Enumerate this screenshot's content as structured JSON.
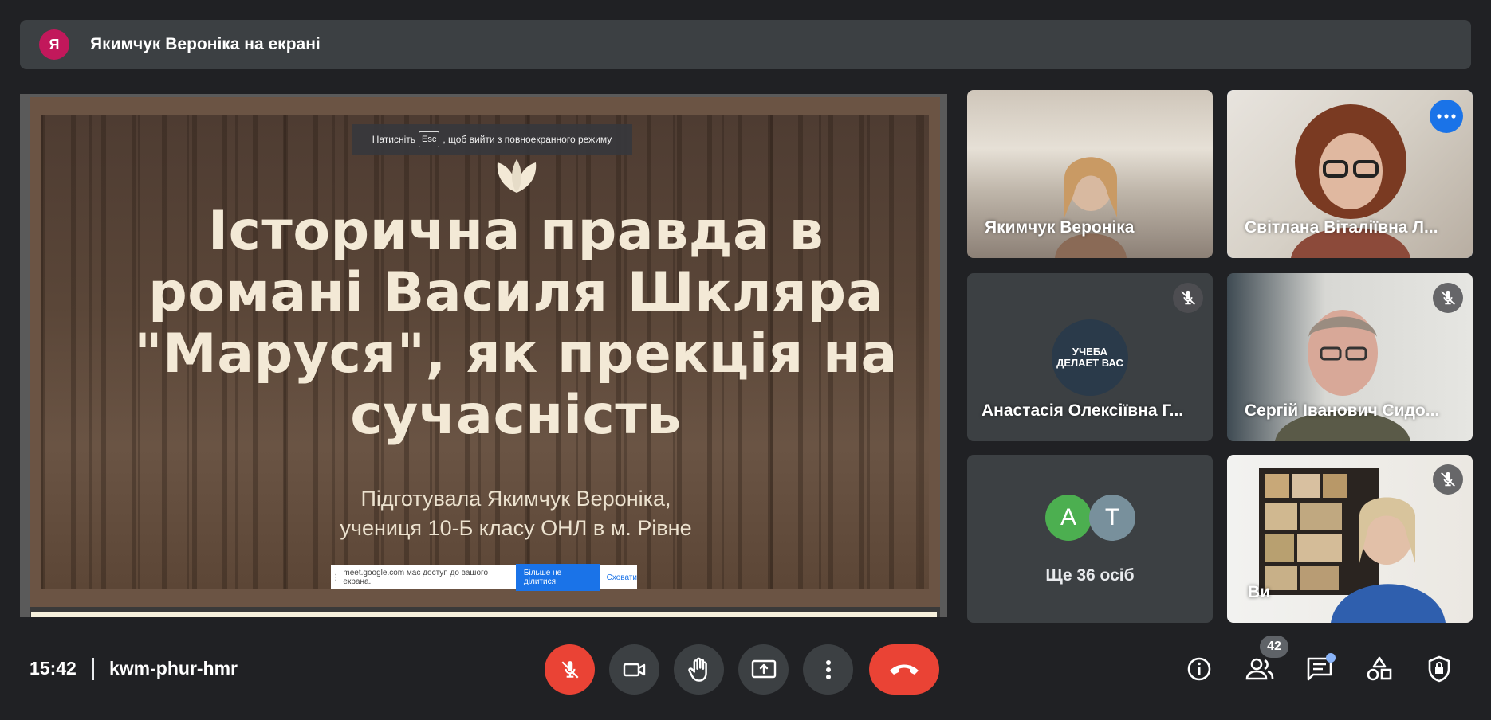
{
  "banner": {
    "avatar_letter": "Я",
    "text": "Якимчук Вероніка на екрані"
  },
  "presentation": {
    "esc_toast": {
      "before": "Натисніть",
      "key": "Esc",
      "after": ", щоб вийти з повноекранного режиму"
    },
    "title": "Історична правда в романі Василя Шкляра \"Маруся\", як прекція на сучасність",
    "subtitle_line1": "Підготувала Якимчук Вероніка,",
    "subtitle_line2": "учениця 10-Б класу ОНЛ в м. Рівне",
    "share_bar": {
      "message": "meet.google.com має доступ до вашого екрана.",
      "stop_label": "Більше не ділитися",
      "hide_label": "Сховати"
    }
  },
  "participants": [
    {
      "name": "Якимчук Вероніка",
      "muted": false
    },
    {
      "name": "Світлана Віталіївна Л...",
      "muted": false,
      "selected": true
    },
    {
      "name": "Анастасія Олексіївна Г...",
      "muted": true,
      "avatar_text": "УЧЕБА ДЕЛАЕТ ВАС"
    },
    {
      "name": "Сергій Іванович Сидо...",
      "muted": true
    },
    {
      "name": "Ви",
      "muted": true
    }
  ],
  "more_tile": {
    "avatars": [
      {
        "letter": "А",
        "color": "#4caf50"
      },
      {
        "letter": "Т",
        "color": "#78909c"
      }
    ],
    "text": "Ще 36 осіб"
  },
  "bottom_bar": {
    "time": "15:42",
    "meeting_code": "kwm-phur-hmr",
    "participants_count": "42",
    "controls": [
      "mic-off",
      "camera",
      "raise-hand",
      "present",
      "more-options",
      "leave-call"
    ],
    "right_icons": [
      "info",
      "people",
      "chat",
      "activities",
      "host-controls"
    ]
  },
  "colors": {
    "background": "#202124",
    "surface": "#3c4043",
    "danger": "#ea4335",
    "accent": "#1a73e8",
    "highlight": "#8ab4f8"
  }
}
